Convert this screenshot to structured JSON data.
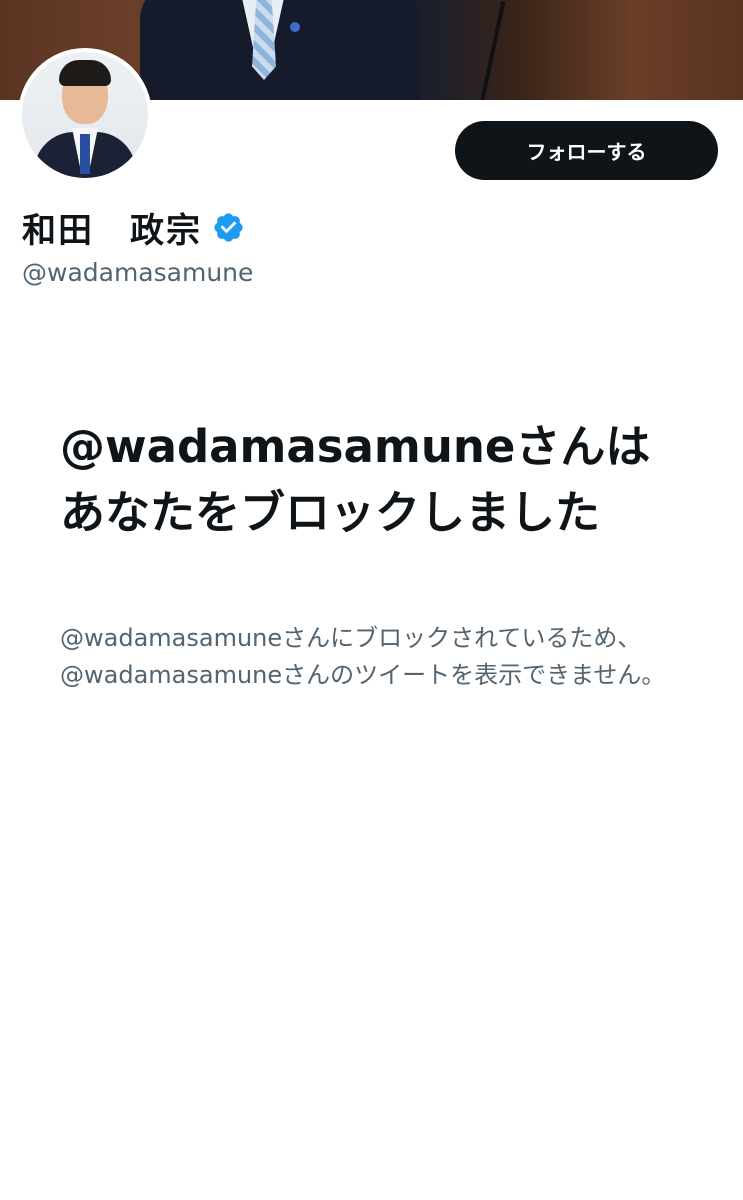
{
  "profile": {
    "display_name": "和田　政宗",
    "handle": "@wadamasamune",
    "verified": true,
    "verified_icon": "verified-badge-icon",
    "verified_color": "#1d9bf0"
  },
  "actions": {
    "follow_label": "フォローする"
  },
  "blocked": {
    "title": "@wadamasamuneさんはあなたをブロックしました",
    "description": "@wadamasamuneさんにブロックされているため、@wadamasamuneさんのツイートを表示できません。"
  },
  "colors": {
    "primary_text": "#0f1419",
    "secondary_text": "#536471",
    "button_bg": "#0f1419",
    "background": "#ffffff"
  }
}
